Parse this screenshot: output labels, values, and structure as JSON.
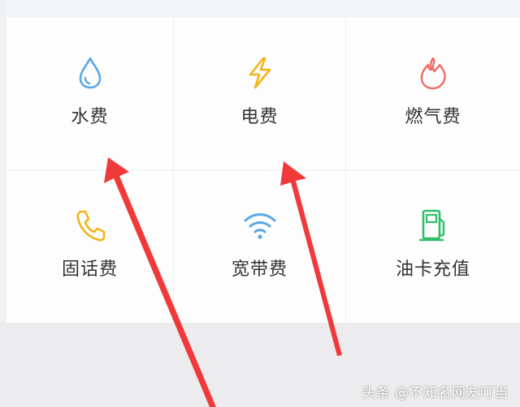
{
  "colors": {
    "water": "#5aa8e8",
    "electric": "#f2b417",
    "gas": "#f06a66",
    "phone": "#f2b417",
    "broadband": "#5aa8e8",
    "fuel": "#2fbf6a",
    "arrow": "#f03a3a"
  },
  "services": [
    {
      "label": "水费",
      "icon": "water-drop-icon"
    },
    {
      "label": "电费",
      "icon": "lightning-bolt-icon"
    },
    {
      "label": "燃气费",
      "icon": "flame-icon"
    },
    {
      "label": "固话费",
      "icon": "telephone-handset-icon"
    },
    {
      "label": "宽带费",
      "icon": "wifi-icon"
    },
    {
      "label": "油卡充值",
      "icon": "fuel-pump-icon"
    }
  ],
  "watermark": "头条 @不知名网友叮当"
}
